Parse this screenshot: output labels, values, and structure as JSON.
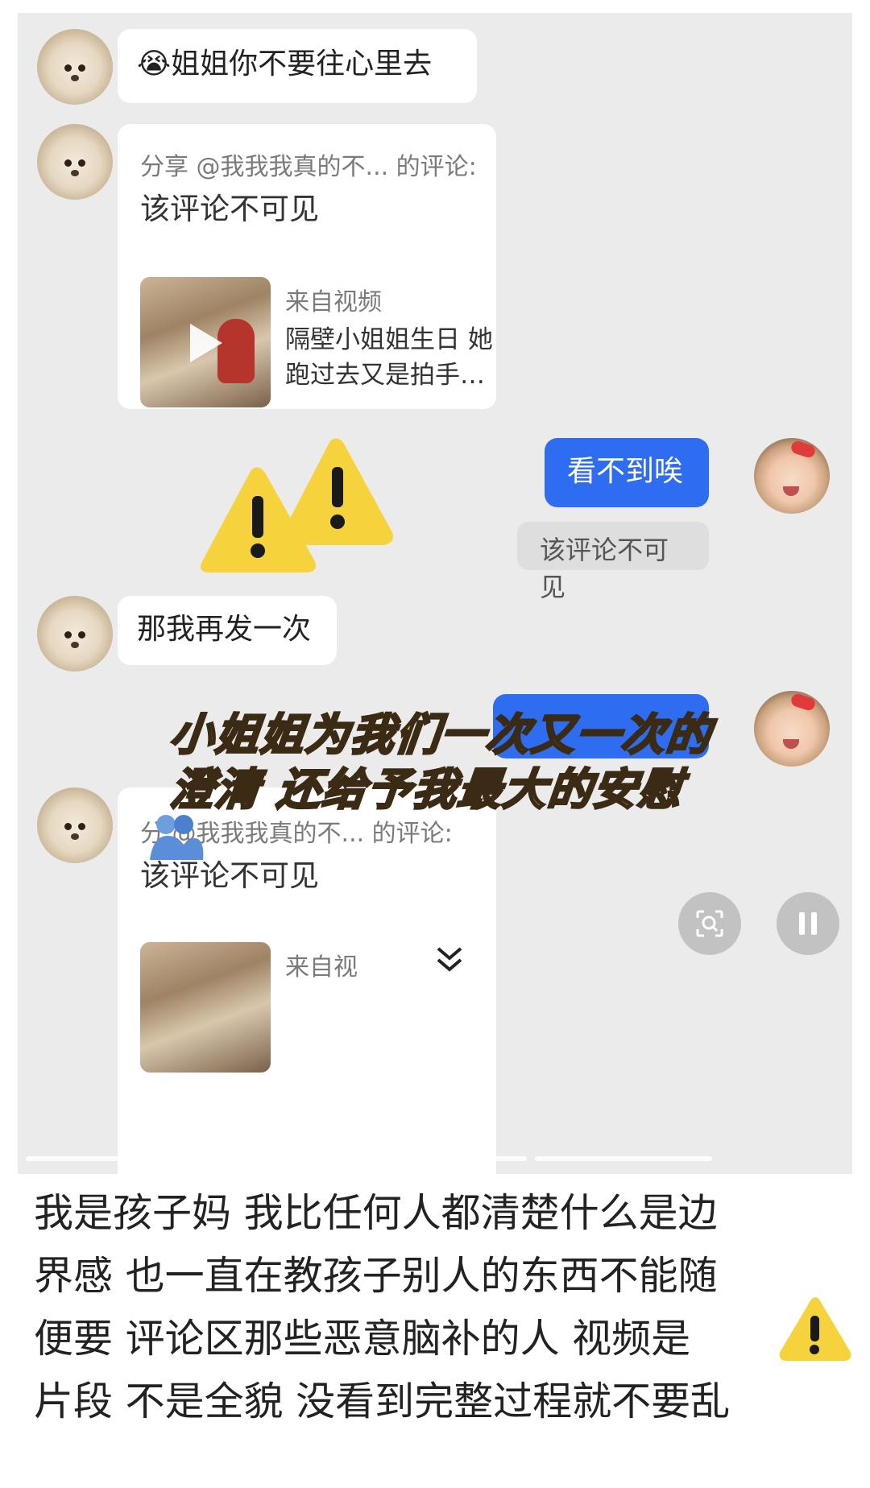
{
  "chat": {
    "msg1": {
      "emoji": "😭",
      "text": "姐姐你不要往心里去"
    },
    "share1": {
      "header": "分享 @我我我真的不... 的评论:",
      "comment": "该评论不可见",
      "from_label": "来自视频",
      "video_title": "隔壁小姐姐生日 她跑过去又是拍手…"
    },
    "reply1": {
      "text": "看不到唉"
    },
    "system1": {
      "text": "该评论不可见"
    },
    "msg2": {
      "text": "那我再发一次"
    },
    "share2": {
      "header": "分 @我我我真的不... 的评论:",
      "comment": "该评论不可见",
      "from_label": "来自视"
    }
  },
  "overlay_caption": {
    "line1": "小姐姐为我们一次又一次的",
    "line2": "澄清 还给予我最大的安慰"
  },
  "controls": {
    "scan_icon": "scan-icon",
    "pause_icon": "pause-icon",
    "chevron_icon": "chevron-down-icon"
  },
  "caption": {
    "line1": "我是孩子妈 我比任何人都清楚什么是边",
    "line2": "界感  也一直在教孩子别人的东西不能随",
    "line3": "便要  评论区那些恶意脑补的人 视频是",
    "line4": "片段 不是全貌 没看到完整过程就不要乱"
  },
  "colors": {
    "chat_bg": "#ebebeb",
    "bubble": "#ffffff",
    "blue_bubble": "#2f6df0",
    "warning_yellow": "#f6d33c",
    "caption_text": "#222222"
  }
}
